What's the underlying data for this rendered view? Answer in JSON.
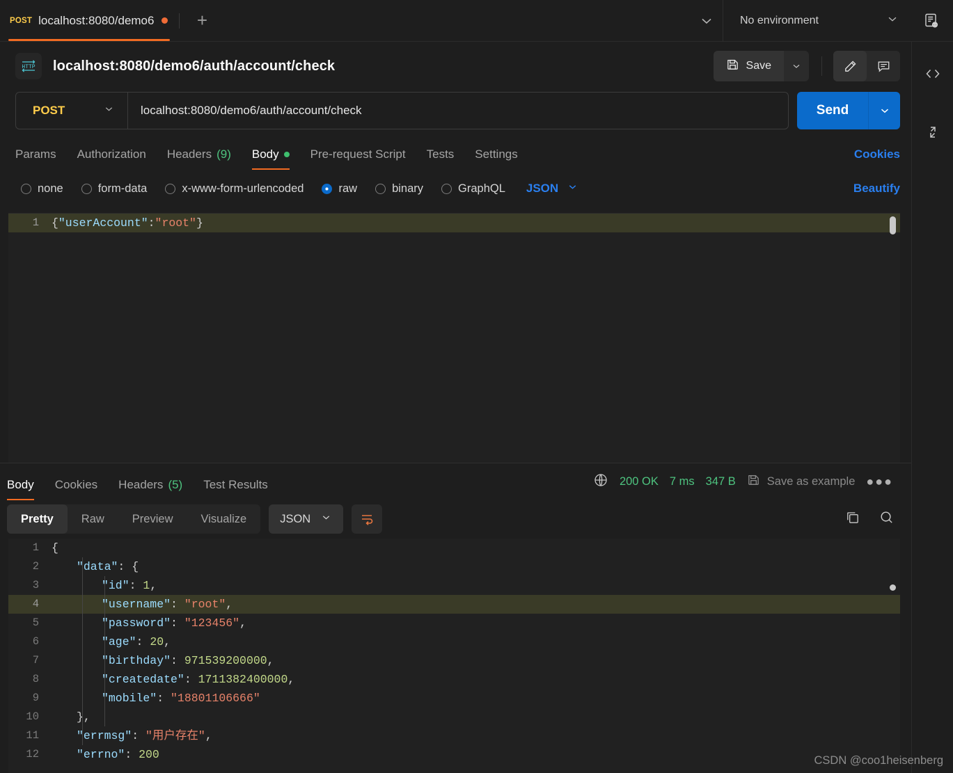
{
  "tabbar": {
    "tab": {
      "method": "POST",
      "name": "localhost:8080/demo6",
      "unsaved_icon": "unsaved-dot"
    },
    "new_tab_label": "+",
    "environment": {
      "value": "No environment",
      "chevron": "chevron-down-icon",
      "quick_look_icon": "environment-quick-look-icon"
    }
  },
  "request_header": {
    "protocol_badge": "HTTP",
    "title": "localhost:8080/demo6/auth/account/check",
    "save_label": "Save",
    "save_icon": "floppy-disk-icon",
    "save_caret": "chevron-down-icon",
    "edit_icon": "pencil-icon",
    "comment_icon": "comment-icon"
  },
  "rail": {
    "code_icon": "code-snippet-icon",
    "expand_icon": "expand-collapse-icon"
  },
  "url_bar": {
    "method": "POST",
    "method_caret": "chevron-down-icon",
    "url": "localhost:8080/demo6/auth/account/check",
    "send_label": "Send",
    "send_caret": "chevron-down-icon"
  },
  "request_tabs": {
    "items": [
      {
        "label": "Params",
        "active": false
      },
      {
        "label": "Authorization",
        "active": false
      },
      {
        "label": "Headers",
        "count": "(9)",
        "active": false
      },
      {
        "label": "Body",
        "active": true,
        "has_dot": true
      },
      {
        "label": "Pre-request Script",
        "active": false
      },
      {
        "label": "Tests",
        "active": false
      },
      {
        "label": "Settings",
        "active": false
      }
    ],
    "cookies_link": "Cookies"
  },
  "body_type": {
    "options": [
      {
        "label": "none",
        "selected": false
      },
      {
        "label": "form-data",
        "selected": false
      },
      {
        "label": "x-www-form-urlencoded",
        "selected": false
      },
      {
        "label": "raw",
        "selected": true
      },
      {
        "label": "binary",
        "selected": false
      },
      {
        "label": "GraphQL",
        "selected": false
      }
    ],
    "format": "JSON",
    "format_caret": "chevron-down-icon",
    "beautify_label": "Beautify"
  },
  "request_body": {
    "lines": [
      {
        "num": "1",
        "highlight": true,
        "tokens": [
          {
            "t": "{",
            "c": "p"
          },
          {
            "t": "\"userAccount\"",
            "c": "k"
          },
          {
            "t": ":",
            "c": "p"
          },
          {
            "t": "\"root\"",
            "c": "s"
          },
          {
            "t": "}",
            "c": "p"
          }
        ]
      }
    ]
  },
  "response": {
    "tabs": [
      {
        "label": "Body",
        "active": true
      },
      {
        "label": "Cookies",
        "active": false
      },
      {
        "label": "Headers",
        "count": "(5)",
        "active": false
      },
      {
        "label": "Test Results",
        "active": false
      }
    ],
    "globe_icon": "globe-icon",
    "status": "200 OK",
    "time": "7 ms",
    "size": "347 B",
    "save_example_label": "Save as example",
    "save_example_icon": "floppy-disk-icon",
    "more_icon": "ellipsis-icon",
    "view_modes": [
      {
        "label": "Pretty",
        "active": true
      },
      {
        "label": "Raw",
        "active": false
      },
      {
        "label": "Preview",
        "active": false
      },
      {
        "label": "Visualize",
        "active": false
      }
    ],
    "format": "JSON",
    "format_caret": "chevron-down-icon",
    "wrap_icon": "wrap-lines-icon",
    "copy_icon": "copy-icon",
    "search_icon": "search-icon",
    "body_lines": [
      {
        "num": "1",
        "indent": 0,
        "highlight": false,
        "tokens": [
          {
            "t": "{",
            "c": "p"
          }
        ]
      },
      {
        "num": "2",
        "indent": 1,
        "highlight": false,
        "tokens": [
          {
            "t": "\"data\"",
            "c": "k"
          },
          {
            "t": ": ",
            "c": "p"
          },
          {
            "t": "{",
            "c": "p"
          }
        ]
      },
      {
        "num": "3",
        "indent": 2,
        "highlight": false,
        "tokens": [
          {
            "t": "\"id\"",
            "c": "k"
          },
          {
            "t": ": ",
            "c": "p"
          },
          {
            "t": "1",
            "c": "n"
          },
          {
            "t": ",",
            "c": "p"
          }
        ]
      },
      {
        "num": "4",
        "indent": 2,
        "highlight": true,
        "tokens": [
          {
            "t": "\"username\"",
            "c": "k"
          },
          {
            "t": ": ",
            "c": "p"
          },
          {
            "t": "\"root\"",
            "c": "s"
          },
          {
            "t": ",",
            "c": "p"
          }
        ]
      },
      {
        "num": "5",
        "indent": 2,
        "highlight": false,
        "tokens": [
          {
            "t": "\"password\"",
            "c": "k"
          },
          {
            "t": ": ",
            "c": "p"
          },
          {
            "t": "\"123456\"",
            "c": "s"
          },
          {
            "t": ",",
            "c": "p"
          }
        ]
      },
      {
        "num": "6",
        "indent": 2,
        "highlight": false,
        "tokens": [
          {
            "t": "\"age\"",
            "c": "k"
          },
          {
            "t": ": ",
            "c": "p"
          },
          {
            "t": "20",
            "c": "n"
          },
          {
            "t": ",",
            "c": "p"
          }
        ]
      },
      {
        "num": "7",
        "indent": 2,
        "highlight": false,
        "tokens": [
          {
            "t": "\"birthday\"",
            "c": "k"
          },
          {
            "t": ": ",
            "c": "p"
          },
          {
            "t": "971539200000",
            "c": "n"
          },
          {
            "t": ",",
            "c": "p"
          }
        ]
      },
      {
        "num": "8",
        "indent": 2,
        "highlight": false,
        "tokens": [
          {
            "t": "\"createdate\"",
            "c": "k"
          },
          {
            "t": ": ",
            "c": "p"
          },
          {
            "t": "1711382400000",
            "c": "n"
          },
          {
            "t": ",",
            "c": "p"
          }
        ]
      },
      {
        "num": "9",
        "indent": 2,
        "highlight": false,
        "tokens": [
          {
            "t": "\"mobile\"",
            "c": "k"
          },
          {
            "t": ": ",
            "c": "p"
          },
          {
            "t": "\"18801106666\"",
            "c": "s"
          }
        ]
      },
      {
        "num": "10",
        "indent": 1,
        "highlight": false,
        "tokens": [
          {
            "t": "}",
            "c": "p"
          },
          {
            "t": ",",
            "c": "p"
          }
        ]
      },
      {
        "num": "11",
        "indent": 1,
        "highlight": false,
        "tokens": [
          {
            "t": "\"errmsg\"",
            "c": "k"
          },
          {
            "t": ": ",
            "c": "p"
          },
          {
            "t": "\"用户存在\"",
            "c": "s"
          },
          {
            "t": ",",
            "c": "p"
          }
        ]
      },
      {
        "num": "12",
        "indent": 1,
        "highlight": false,
        "tokens": [
          {
            "t": "\"errno\"",
            "c": "k"
          },
          {
            "t": ": ",
            "c": "p"
          },
          {
            "t": "200",
            "c": "n"
          }
        ]
      }
    ]
  },
  "watermark": "CSDN @coo1heisenberg",
  "colors": {
    "accent_orange": "#f26b22",
    "send_blue": "#0b6bcb",
    "link_blue": "#2a7fef",
    "status_green": "#4ec37f",
    "method_yellow": "#ffcd4b",
    "json_key": "#9cdcfe",
    "json_string": "#e8836a",
    "json_number": "#c3d98a",
    "highlight_line": "#3a3b27"
  }
}
